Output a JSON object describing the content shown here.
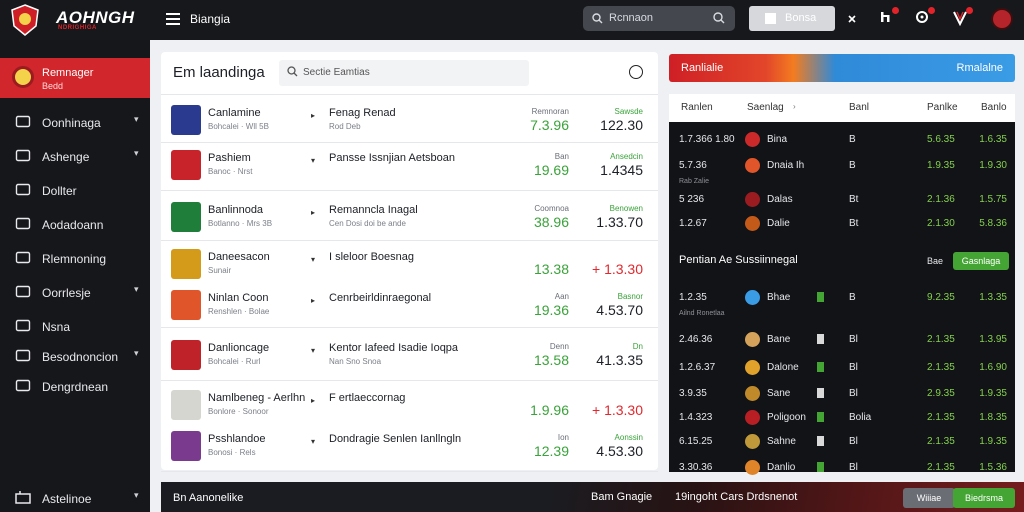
{
  "colors": {
    "accent": "#d1262b",
    "green": "#3aa23a",
    "dark": "#16171b",
    "blue": "#3b9ce6"
  },
  "topbar": {
    "brand": "AOHNGH",
    "brand_sub": "NDRIGHIGA",
    "title": "Biangia",
    "search_placeholder": "Rcnnaon",
    "button_label": "Bonsa",
    "icons": [
      "search-icon",
      "close-icon",
      "user-icon",
      "chart-icon",
      "shield-icon",
      "avatar"
    ]
  },
  "sidebar": {
    "active": {
      "label": "Remnager",
      "sub": "Bedd"
    },
    "items": [
      {
        "label": "Oonhinaga",
        "icon": "monitor-icon",
        "chevron": true
      },
      {
        "label": "Ashenge",
        "icon": "window-icon",
        "chevron": true
      },
      {
        "label": "Dollter",
        "icon": "search-icon",
        "chevron": false
      },
      {
        "label": "Aodadoann",
        "icon": "list-icon",
        "chevron": false
      },
      {
        "label": "Rlemnoning",
        "icon": "chart-icon",
        "chevron": false
      },
      {
        "label": "Oorrlesje",
        "icon": "clock-icon",
        "chevron": true
      },
      {
        "label": "Nsna",
        "icon": "grid-icon",
        "chevron": false
      },
      {
        "label": "Besodnoncion",
        "icon": "folder-icon",
        "chevron": true
      },
      {
        "label": "Dengrdnean",
        "icon": "file-icon",
        "chevron": false
      }
    ],
    "bottom": {
      "label": "Astelinoe",
      "chevron": true
    }
  },
  "main": {
    "title": "Em laandinga",
    "search_placeholder": "Sectie Eamtias",
    "rows": [
      {
        "name": "Canlamine",
        "sub": "Bohcalei · Wll 5B",
        "desc": "Fenag Renad",
        "desc2": "Rod Deb",
        "clab": "Remnoran",
        "cval": "7.3.96",
        "rlab": "Sawsde",
        "rval": "122.30",
        "thumb": "#2a3b8f"
      },
      {
        "name": "Pashiem",
        "sub": "Banoc · Nrst",
        "desc": "Pansse Issnjian Aetsboan",
        "desc2": "",
        "clab": "Ban",
        "cval": "19.69",
        "rlab": "Ansedcin",
        "rval": "1.4345",
        "thumb": "#c8222a"
      },
      {
        "name": "Banlinnoda",
        "sub": "Botlanno · Mrs 3B",
        "desc": "Remanncla Inagal",
        "desc2": "Cen Dosi doi be ande",
        "clab": "Coomnoa",
        "cval": "38.96",
        "rlab": "Benowen",
        "rval": "1.33.70",
        "thumb": "#1f7f3a"
      },
      {
        "name": "Daneesacon",
        "sub": "Sunair",
        "desc": "I sleloor Boesnag",
        "desc2": "",
        "clab": "",
        "cval": "13.38",
        "rlab": "",
        "rval": "+ 1.3.30",
        "thumb": "#d49a1a",
        "rvalRed": true
      },
      {
        "name": "Ninlan Coon",
        "sub": "Renshlen · Bolae",
        "desc": "Cenrbeirldinraegonal",
        "desc2": "",
        "clab": "Aan",
        "cval": "19.36",
        "rlab": "Basnor",
        "rval": "4.53.70",
        "thumb": "#e0562a"
      },
      {
        "name": "Danlioncage",
        "sub": "Bohcalei · Rurl",
        "desc": "Kentor Iafeed Isadie Ioqpa",
        "desc2": "Nan Sno Snoa",
        "clab": "Denn",
        "cval": "13.58",
        "rlab": "Dn",
        "rval": "41.3.35",
        "thumb": "#c0222a"
      },
      {
        "name": "Namlbeneg - Aerlhn",
        "sub": "Bonlore · Sonoor",
        "desc": "F ertlaeccornag",
        "desc2": "",
        "clab": "",
        "cval": "1.9.96",
        "rlab": "",
        "rval": "+ 1.3.30",
        "thumb": "#d6d6d0",
        "rvalRed": true
      },
      {
        "name": "Psshlandoe",
        "sub": "Bonosi · Rels",
        "desc": "Dondragie Senlen Ianllngln",
        "desc2": "",
        "clab": "Ion",
        "cval": "12.39",
        "rlab": "Aonssin",
        "rval": "4.53.30",
        "thumb": "#7a3b8f"
      }
    ]
  },
  "right": {
    "header_left": "Ranlialie",
    "header_right": "Rmalalne",
    "cols": [
      "Ranlen",
      "Saenlag",
      "Banl",
      "Panlke",
      "Banlo"
    ],
    "rows": [
      {
        "c1": "1.7.366  1.80",
        "name": "Bina",
        "c3": "B",
        "c4": "5.6.35",
        "c5": "1.6.35",
        "ic": "#cc2a2a",
        "sub": ""
      },
      {
        "c1": "5.7.36",
        "name": "Dnaia Ih",
        "c3": "B",
        "c4": "1.9.35",
        "c5": "1.9.30",
        "ic": "#e0562a",
        "sub": "Rab Zalie"
      },
      {
        "c1": "5 236",
        "name": "Dalas",
        "c3": "Bt",
        "c4": "2.1.36",
        "c5": "1.5.75",
        "ic": "#9b1c20",
        "sub": ""
      },
      {
        "c1": "1.2.67",
        "name": "Dalie",
        "c3": "Bt",
        "c4": "2.1.30",
        "c5": "5.8.36",
        "ic": "#c45a1a",
        "sub": ""
      }
    ],
    "section_title": "Pentian Ae Sussiinnegal",
    "section_right": "Bae",
    "section_button": "Gasnlaga",
    "rows2": [
      {
        "c1": "1.2.35",
        "name": "Bhae",
        "c3": "B",
        "c4": "9.2.35",
        "c5": "1.3.35",
        "ic": "#3b9ce6",
        "sub": "Ailnd Ronetlaa"
      },
      {
        "c1": "2.46.36",
        "name": "Bane",
        "c3": "Bl",
        "c4": "2.1.35",
        "c5": "1.3.95",
        "ic": "#d4a25a"
      },
      {
        "c1": "1.2.6.37",
        "name": "Dalone",
        "c3": "Bl",
        "c4": "2.1.35",
        "c5": "1.6.90",
        "ic": "#e0a22a"
      },
      {
        "c1": "3.9.35",
        "name": "Sane",
        "c3": "Bl",
        "c4": "2.9.35",
        "c5": "1.9.35",
        "ic": "#c08a2a"
      },
      {
        "c1": "1.4.323",
        "name": "Poligoon",
        "c3": "Bolia",
        "c4": "2.1.35",
        "c5": "1.8.35",
        "ic": "#b81f24"
      },
      {
        "c1": "6.15.25",
        "name": "Sahne",
        "c3": "Bl",
        "c4": "2.1.35",
        "c5": "1.9.35",
        "ic": "#c09a3a"
      },
      {
        "c1": "3.30.36",
        "name": "Danlio",
        "c3": "Bl",
        "c4": "2.1.35",
        "c5": "1.5.36",
        "ic": "#e0842a"
      }
    ]
  },
  "bottom": {
    "left": "Bn Aanonelike",
    "mid1": "Bam Gnagie",
    "mid2": "19ingoht Cars Drdsnenot",
    "btn1": "Wiiiae",
    "btn2": "Biedrsma"
  }
}
